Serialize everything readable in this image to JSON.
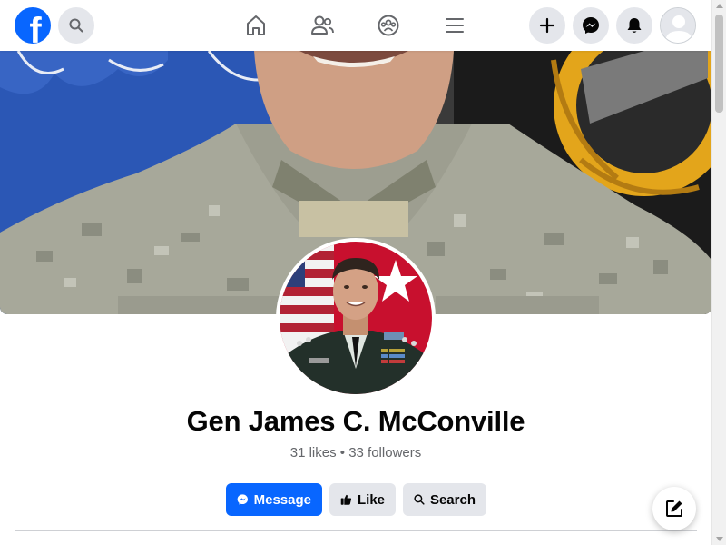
{
  "nav": {
    "logo_letter": "f",
    "icons": [
      "facebook-logo",
      "search-icon",
      "home-icon",
      "friends-icon",
      "groups-icon",
      "menu-icon",
      "plus-icon",
      "messenger-icon",
      "bell-icon",
      "avatar"
    ]
  },
  "profile": {
    "name": "Gen James C. McConville",
    "stats": "31 likes • 33 followers"
  },
  "actions": {
    "message_label": "Message",
    "like_label": "Like",
    "search_label": "Search"
  },
  "colors": {
    "brand": "#0866ff",
    "secondary_button": "#e4e6eb",
    "text_primary": "#050505",
    "text_secondary": "#65676b"
  }
}
